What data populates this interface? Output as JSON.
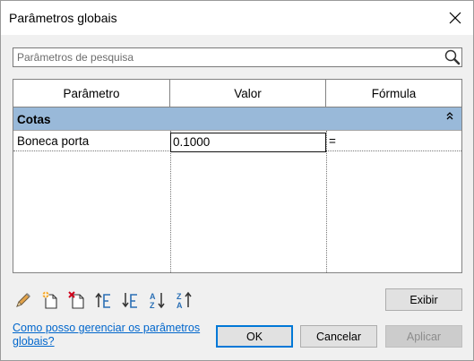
{
  "window": {
    "title": "Parâmetros globais"
  },
  "search": {
    "placeholder": "Parâmetros de pesquisa",
    "value": ""
  },
  "table": {
    "columns": [
      "Parâmetro",
      "Valor",
      "Fórmula"
    ],
    "groups": [
      {
        "name": "Cotas",
        "expanded": true,
        "rows": [
          {
            "parameter": "Boneca porta",
            "value": "0.1000",
            "formula": "="
          }
        ]
      }
    ]
  },
  "toolbar": {
    "icons": [
      "edit-pencil-icon",
      "new-parameter-icon",
      "delete-parameter-icon",
      "move-up-icon",
      "move-down-icon",
      "sort-ascending-icon",
      "sort-descending-icon"
    ]
  },
  "buttons": {
    "show": "Exibir",
    "ok": "OK",
    "cancel": "Cancelar",
    "apply": "Aplicar",
    "apply_enabled": false
  },
  "help": {
    "link_text": "Como posso gerenciar os parâmetros globais?"
  },
  "colors": {
    "group_header": "#99b9d9",
    "link": "#0066cc",
    "accent": "#0078d7"
  }
}
